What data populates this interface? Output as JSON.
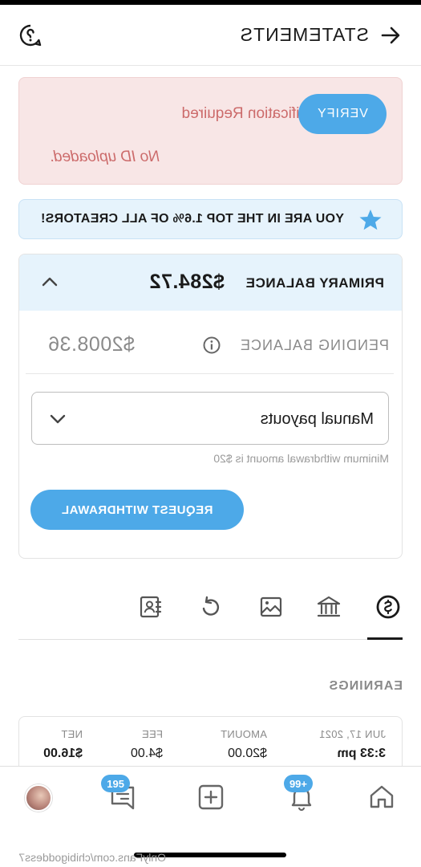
{
  "header": {
    "title": "STATEMENTS"
  },
  "alert": {
    "message": "Updated Verification Required",
    "sub_message": "No ID uploaded.",
    "verify_label": "VERIFY"
  },
  "rank_banner": {
    "text": "YOU ARE IN THE TOP 1.6% OF ALL CREATORS!",
    "icon": "star-icon",
    "icon_color": "#4da9e8"
  },
  "balance": {
    "primary_label": "PRIMARY BALANCE",
    "primary_amount": "$284.72",
    "pending_label": "PENDING BALANCE",
    "pending_amount": "$2008.36",
    "payout_method": "Manual payouts",
    "min_note": "Minimum withdrawal amount is $20",
    "withdraw_label": "REQUEST WITHDRAWAL"
  },
  "tabs": [
    {
      "icon": "dollar-circle-icon",
      "selected": true
    },
    {
      "icon": "bank-icon"
    },
    {
      "icon": "image-icon"
    },
    {
      "icon": "redo-icon"
    },
    {
      "icon": "contact-card-icon"
    }
  ],
  "earnings": {
    "title": "EARNINGS",
    "columns": [
      "JUN 17, 2021",
      "AMOUNT",
      "FEE",
      "NET"
    ],
    "row": {
      "time": "3:33 pm",
      "amount": "$20.00",
      "fee": "$4.00",
      "net": "$16.00"
    }
  },
  "bottom_nav": {
    "notifications_badge": "99+",
    "messages_badge": "195"
  },
  "watermark": "OnlyFans.com/chibigoddess7",
  "colors": {
    "accent": "#4da9e8",
    "alert_bg": "#f8e6e6",
    "alert_text": "#cc6b6b",
    "info_bg": "#e6f3fc"
  }
}
